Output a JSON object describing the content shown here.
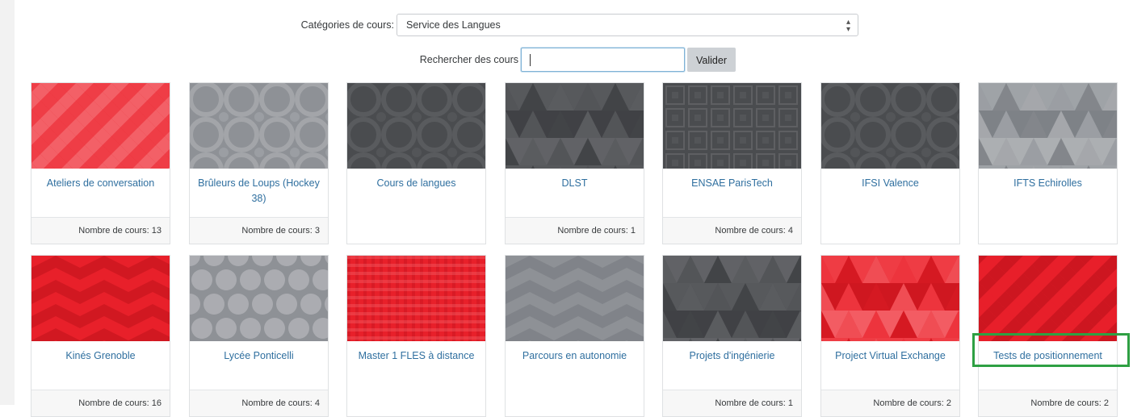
{
  "filter": {
    "label": "Catégories de cours:",
    "selected": "Service des Langues"
  },
  "search": {
    "label": "Rechercher des cours",
    "value": "",
    "button": "Valider"
  },
  "count_prefix": "Nombre de cours: ",
  "colors": {
    "red": "#e8202a",
    "grey": "#8e9196",
    "dark": "#4a4c4f",
    "title": "#2f6f9f",
    "highlight": "#2ea043"
  },
  "highlighted_card": "Tests de positionnement",
  "cards": [
    {
      "title": "Ateliers de conversation",
      "count": "13",
      "theme": "red",
      "pattern": "diamonds"
    },
    {
      "title": "Brûleurs de Loups (Hockey 38)",
      "count": "3",
      "theme": "grey",
      "pattern": "rings"
    },
    {
      "title": "Cours de langues",
      "count": "",
      "theme": "dark",
      "pattern": "rings"
    },
    {
      "title": "DLST",
      "count": "1",
      "theme": "dark",
      "pattern": "triangles"
    },
    {
      "title": "ENSAE ParisTech",
      "count": "4",
      "theme": "dark",
      "pattern": "squares"
    },
    {
      "title": "IFSI Valence",
      "count": "",
      "theme": "dark",
      "pattern": "rings"
    },
    {
      "title": "IFTS Echirolles",
      "count": "",
      "theme": "grey",
      "pattern": "triangles"
    },
    {
      "title": "Kinés Grenoble",
      "count": "16",
      "theme": "red",
      "pattern": "chevrons"
    },
    {
      "title": "Lycée Ponticelli",
      "count": "4",
      "theme": "grey",
      "pattern": "octagons"
    },
    {
      "title": "Master 1 FLES à distance",
      "count": "",
      "theme": "red",
      "pattern": "plaid"
    },
    {
      "title": "Parcours en autonomie",
      "count": "",
      "theme": "grey",
      "pattern": "chevrons"
    },
    {
      "title": "Projets d'ingénierie",
      "count": "1",
      "theme": "dark",
      "pattern": "triangles"
    },
    {
      "title": "Project Virtual Exchange",
      "count": "2",
      "theme": "red",
      "pattern": "triangles"
    },
    {
      "title": "Tests de positionnement",
      "count": "2",
      "theme": "red",
      "pattern": "diamonds"
    }
  ]
}
